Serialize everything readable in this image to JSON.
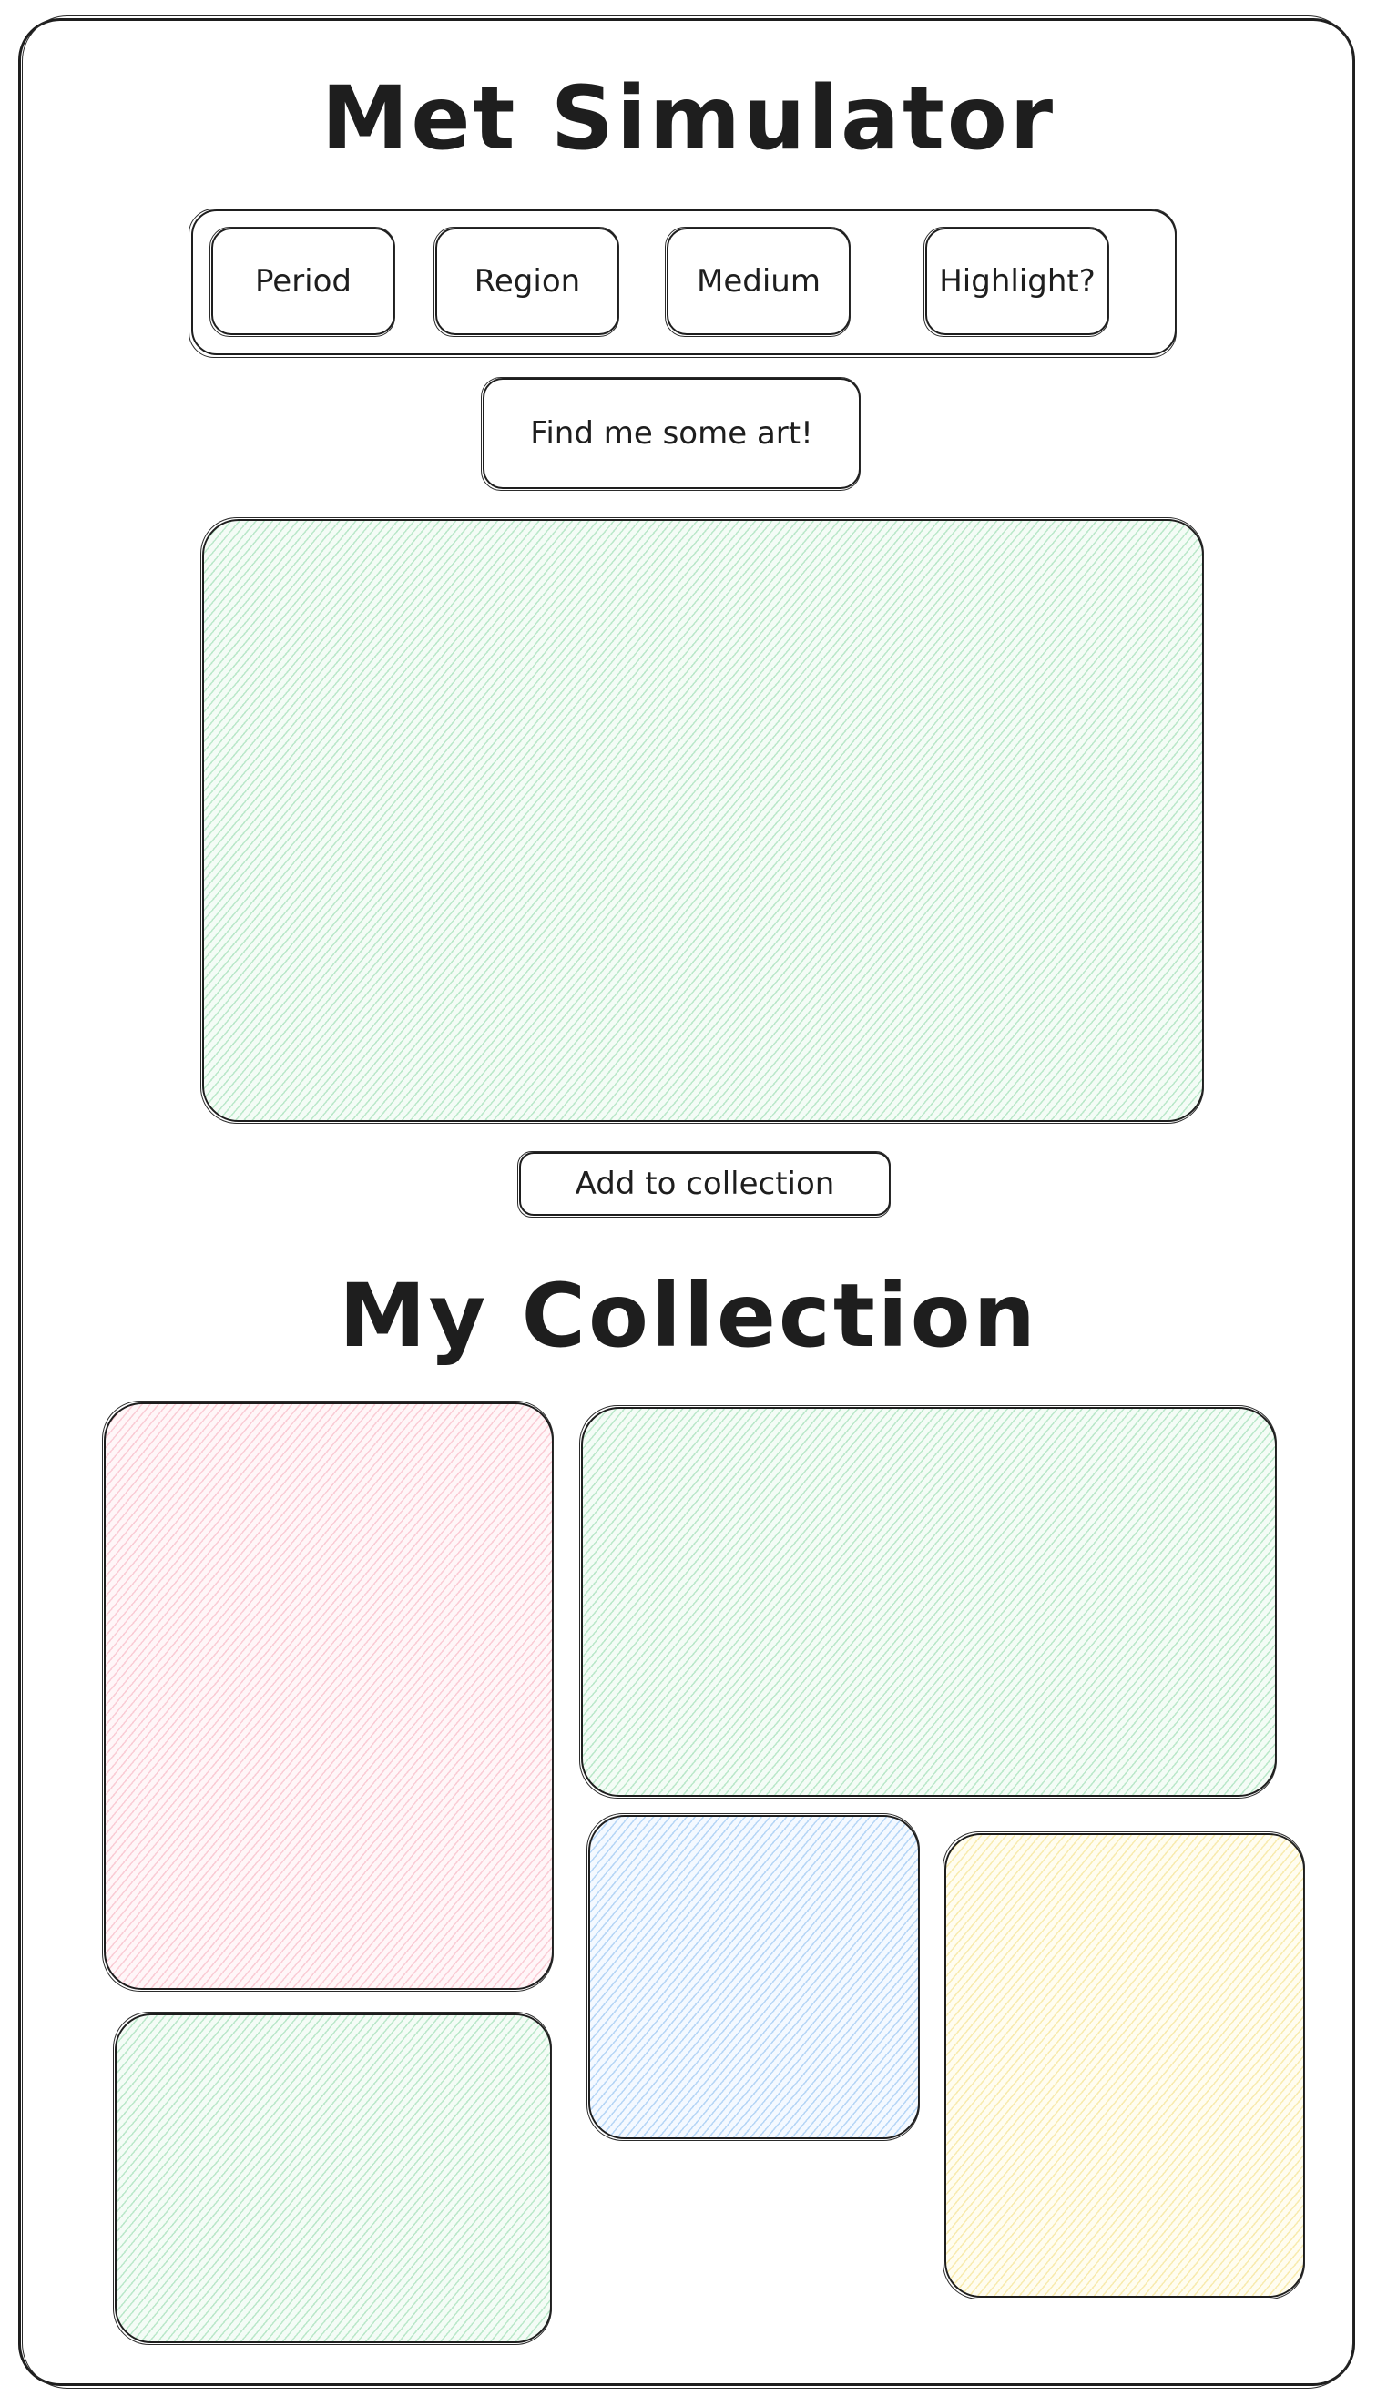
{
  "header": {
    "title": "Met Simulator"
  },
  "filters": {
    "period_label": "Period",
    "region_label": "Region",
    "medium_label": "Medium",
    "highlight_label": "Highlight?"
  },
  "actions": {
    "find_label": "Find me some art!",
    "add_label": "Add to collection"
  },
  "collection": {
    "title": "My Collection",
    "items": [
      {
        "fill": "hatch-red",
        "color": "#f5aab9"
      },
      {
        "fill": "hatch-green",
        "color": "#8cd7a5"
      },
      {
        "fill": "hatch-blue",
        "color": "#8cbef0"
      },
      {
        "fill": "hatch-yellow",
        "color": "#f5e18c"
      },
      {
        "fill": "hatch-green",
        "color": "#8cd7a5"
      }
    ]
  },
  "featured_art": {
    "fill": "hatch-green",
    "color": "#8cd7a5"
  }
}
